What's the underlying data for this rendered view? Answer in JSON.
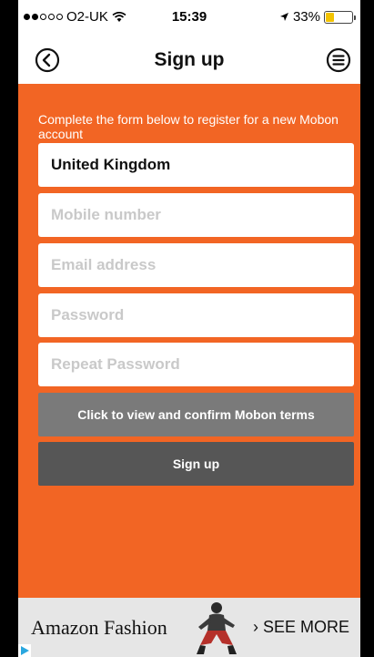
{
  "status_bar": {
    "carrier": "O2-UK",
    "time": "15:39",
    "battery_percent": "33%",
    "battery_level": 0.33,
    "signal_bars_filled": 2,
    "signal_bars_total": 5
  },
  "nav": {
    "title": "Sign up",
    "back_icon": "back-circle-icon",
    "menu_icon": "menu-circle-icon"
  },
  "form": {
    "intro": "Complete the form below to register for a new Mobon account",
    "country_value": "United Kingdom",
    "mobile_placeholder": "Mobile number",
    "email_placeholder": "Email address",
    "password_placeholder": "Password",
    "repeat_password_placeholder": "Repeat Password",
    "terms_button": "Click to view and confirm Mobon terms",
    "signup_button": "Sign up"
  },
  "ad": {
    "brand": "Amazon Fashion",
    "cta": "› SEE MORE"
  },
  "colors": {
    "background": "#f26524",
    "terms_button": "#7a7a7a",
    "signup_button": "#565656",
    "battery": "#f3c300"
  }
}
